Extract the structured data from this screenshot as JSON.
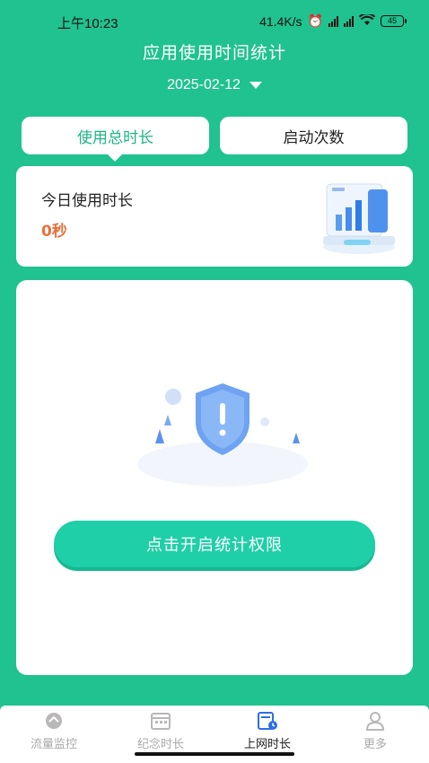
{
  "status_bar": {
    "time": "上午10:23",
    "network_speed": "41.4K/s",
    "battery": "45"
  },
  "header": {
    "title": "应用使用时间统计",
    "date": "2025-02-12"
  },
  "tabs": [
    {
      "label": "使用总时长",
      "active": true
    },
    {
      "label": "启动次数",
      "active": false
    }
  ],
  "today": {
    "label": "今日使用时长",
    "value": "0秒"
  },
  "permission": {
    "button_label": "点击开启统计权限"
  },
  "bottom_nav": [
    {
      "label": "流量监控",
      "icon": "traffic-icon",
      "active": false
    },
    {
      "label": "纪念时长",
      "icon": "calendar-icon",
      "active": false
    },
    {
      "label": "上网时长",
      "icon": "browse-clock-icon",
      "active": true
    },
    {
      "label": "更多",
      "icon": "user-icon",
      "active": false
    }
  ],
  "colors": {
    "brand_green": "#20c28f",
    "accent_text": "#1db485",
    "value_orange": "#e8713c",
    "button": "#1fcfa8"
  }
}
